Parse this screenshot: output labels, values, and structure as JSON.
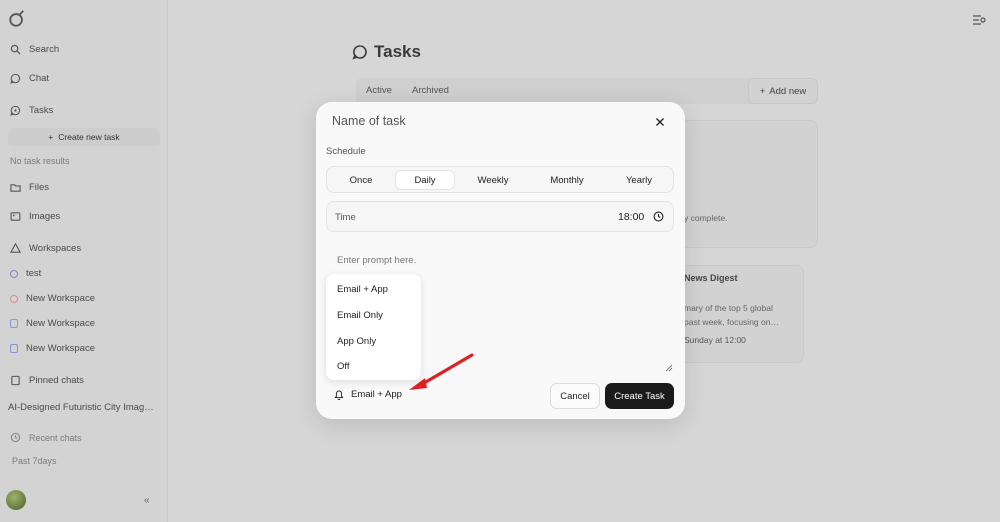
{
  "sidebar": {
    "search": "Search",
    "chat": "Chat",
    "tasks": "Tasks",
    "create_task": "Create new task",
    "no_results": "No task results",
    "files": "Files",
    "images": "Images",
    "workspaces": "Workspaces",
    "workspace_items": [
      {
        "label": "test",
        "color": "#8a7fd6"
      },
      {
        "label": "New Workspace",
        "color": "#d98b8b"
      },
      {
        "label": "New Workspace",
        "color": "#7f9fd6"
      },
      {
        "label": "New Workspace",
        "color": "#8a8fd6"
      }
    ],
    "pinned_chats": "Pinned chats",
    "pinned_item": "AI-Designed Futuristic City Imag…",
    "recent_chats": "Recent chats",
    "recent_muted": "Past 7days"
  },
  "page": {
    "title": "Tasks",
    "tabs": [
      "Active",
      "Archived"
    ],
    "add_new": "Add new",
    "bg_text_1": "y complete.",
    "bg_card_title": "News Digest",
    "bg_card_line1": "mary of the top 5 global",
    "bg_card_line2": "past week, focusing on…",
    "bg_card_line3": "Sunday at 12:00"
  },
  "modal": {
    "title": "Name of task",
    "schedule_label": "Schedule",
    "schedule_options": [
      "Once",
      "Daily",
      "Weekly",
      "Monthly",
      "Yearly"
    ],
    "schedule_selected": "Daily",
    "time_label": "Time",
    "time_value": "18:00",
    "prompt_placeholder": "Enter prompt here.",
    "notify_options": [
      "Email + App",
      "Email Only",
      "App Only",
      "Off"
    ],
    "notify_selected": "Email + App",
    "cancel": "Cancel",
    "create": "Create Task"
  },
  "colors": {
    "annotation_arrow": "#e02020",
    "primary_button": "#1b1b1b"
  }
}
